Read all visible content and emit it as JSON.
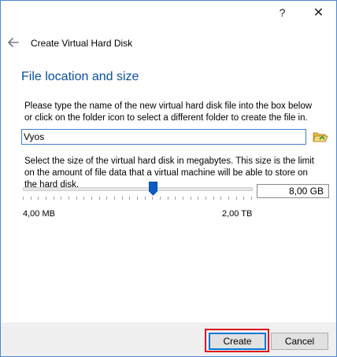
{
  "window": {
    "help_glyph": "?",
    "close_glyph": "✕"
  },
  "wizard": {
    "title": "Create Virtual Hard Disk",
    "back_icon": "back-arrow-icon"
  },
  "section": {
    "heading": "File location and size",
    "location_description": "Please type the name of the new virtual hard disk file into the box below or click on the folder icon to select a different folder to create the file in.",
    "file_name_value": "Vyos",
    "folder_icon": "folder-open-icon",
    "size_description": "Select the size of the virtual hard disk in megabytes. This size is the limit on the amount of file data that a virtual machine will be able to store on the hard disk.",
    "size_value": "8,00 GB",
    "slider_fraction": 0.57,
    "size_min_label": "4,00 MB",
    "size_max_label": "2,00 TB"
  },
  "buttons": {
    "create_label": "Create",
    "cancel_label": "Cancel"
  },
  "colors": {
    "heading": "#0b4fa3",
    "highlight": "#e0141e",
    "slider_handle": "#0b5cc7",
    "focus_border": "#3c7fd1"
  }
}
